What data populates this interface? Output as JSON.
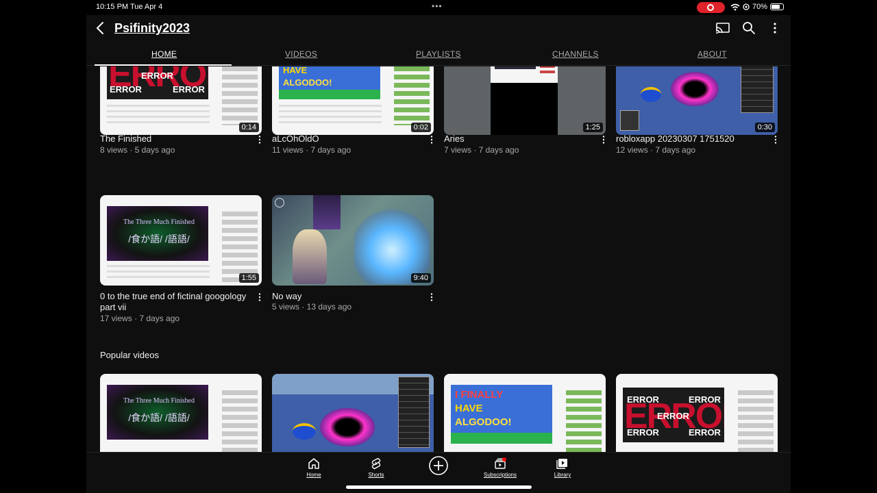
{
  "status_bar": {
    "time": "10:15 PM  Tue Apr 4",
    "battery_percent": "70%",
    "recording": true
  },
  "header": {
    "back_icon": "chevron-left-icon",
    "channel_name": "Psifinity2023",
    "actions": [
      "cast-icon",
      "search-icon",
      "more-vertical-icon"
    ]
  },
  "tabs": [
    {
      "label": "HOME",
      "active": true
    },
    {
      "label": "VIDEOS",
      "active": false
    },
    {
      "label": "PLAYLISTS",
      "active": false
    },
    {
      "label": "CHANNELS",
      "active": false
    },
    {
      "label": "ABOUT",
      "active": false
    }
  ],
  "videos": [
    {
      "title": "The Finished",
      "meta": "8 views · 5 days ago",
      "duration": "0:14"
    },
    {
      "title": "aLcOhOldO",
      "meta": "11 views · 7 days ago",
      "duration": "0:02"
    },
    {
      "title": "Aries",
      "meta": "7 views · 7 days ago",
      "duration": "1:25"
    },
    {
      "title": "robloxapp 20230307 1751520",
      "meta": "12 views · 7 days ago",
      "duration": "0:30"
    },
    {
      "title": "0 to the true end of fictinal googology part vii",
      "meta": "17 views · 7 days ago",
      "duration": "1:55"
    },
    {
      "title": "No way",
      "meta": "5 views · 13 days ago",
      "duration": "9:40"
    }
  ],
  "popular": {
    "title": "Popular videos"
  },
  "thumb_text": {
    "error_big": "ERROR",
    "error_small": "ERROR",
    "finally": "I FINALLY",
    "have": "HAVE",
    "algodoo": "ALGODOO!",
    "three_much": "The Three Much Finished",
    "glyphs": "/食か語/ /語語/"
  },
  "bottom_nav": [
    {
      "label": "Home",
      "icon": "home-icon"
    },
    {
      "label": "Shorts",
      "icon": "shorts-icon"
    },
    {
      "label": "",
      "icon": "create-plus-icon"
    },
    {
      "label": "Subscriptions",
      "icon": "subscriptions-icon"
    },
    {
      "label": "Library",
      "icon": "library-icon"
    }
  ],
  "colors": {
    "background": "#0f0f0f",
    "text_primary": "#f1f1f1",
    "text_secondary": "#aaaaaa",
    "record_red": "#e0222a"
  }
}
